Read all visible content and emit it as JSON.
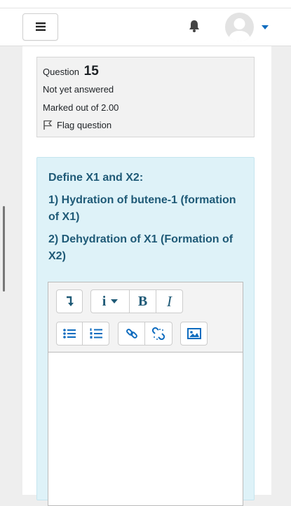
{
  "navbar": {
    "menu_icon": "hamburger-icon",
    "bell_icon": "bell-icon",
    "avatar_icon": "user-avatar",
    "caret_icon": "caret-down-icon"
  },
  "question_info": {
    "label": "Question",
    "number": "15",
    "state": "Not yet answered",
    "grade": "Marked out of 2.00",
    "flag_label": "Flag question"
  },
  "question_text": {
    "intro": "Define X1 and X2:",
    "item1": "1) Hydration of butene-1 (formation of X1)",
    "item2": "2) Dehydration of X1 (Formation of X2)"
  },
  "editor": {
    "toolbar_row1": [
      "collapse",
      "paragraph-style",
      "bold",
      "italic"
    ],
    "toolbar_row2": [
      "unordered-list",
      "ordered-list",
      "link",
      "unlink",
      "image"
    ],
    "bold_label": "B",
    "italic_label": "I",
    "info_label": "i",
    "content": ""
  },
  "colors": {
    "accent": "#0f6cbf",
    "question_text": "#1f5a77",
    "question_bg": "#def2f8",
    "info_bg": "#f2f2f2"
  }
}
